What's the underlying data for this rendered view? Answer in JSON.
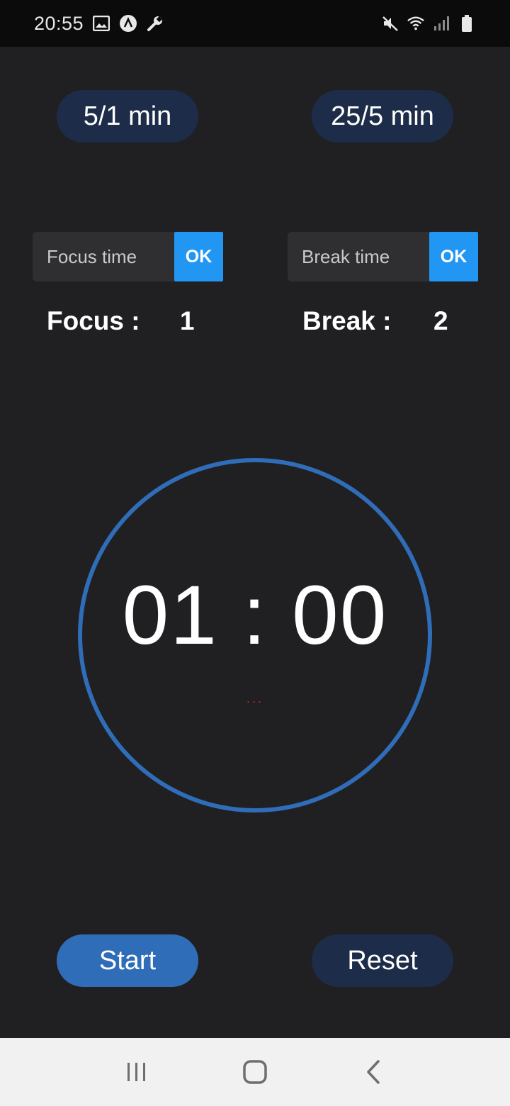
{
  "status_bar": {
    "time": "20:55",
    "icons_left": [
      "image-icon",
      "app-icon",
      "wrench-icon"
    ],
    "icons_right": [
      "mute-icon",
      "wifi-icon",
      "signal-icon",
      "battery-icon"
    ]
  },
  "presets": {
    "short_label": "5/1 min",
    "long_label": "25/5 min"
  },
  "inputs": {
    "focus_placeholder": "Focus time",
    "focus_ok": "OK",
    "break_placeholder": "Break time",
    "break_ok": "OK"
  },
  "stats": {
    "focus_label": "Focus :",
    "focus_value": "1",
    "break_label": "Break :",
    "break_value": "2"
  },
  "timer": {
    "display": "01 : 00",
    "indicator": "...",
    "ring_color": "#2f6db8"
  },
  "actions": {
    "start_label": "Start",
    "reset_label": "Reset"
  },
  "nav_bar": {
    "icons": [
      "recent-apps-icon",
      "home-icon",
      "back-icon"
    ]
  },
  "colors": {
    "background": "#202022",
    "preset_bg": "#1d2c48",
    "ok_bg": "#2196f3",
    "start_bg": "#2f6db8",
    "reset_bg": "#1d2c48"
  }
}
